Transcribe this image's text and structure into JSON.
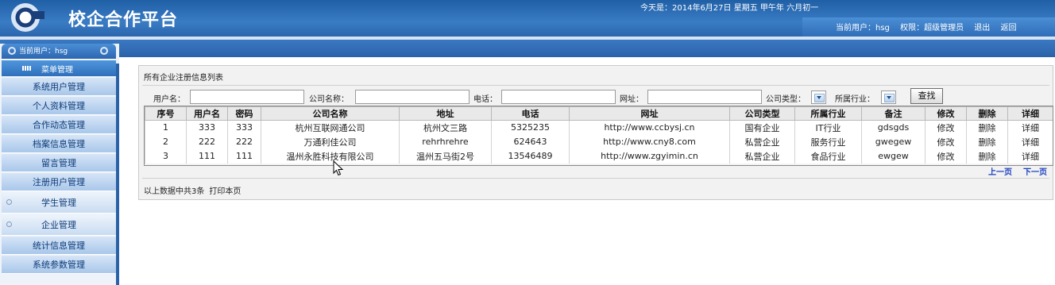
{
  "header": {
    "title": "校企合作平台",
    "date": "今天是：2014年6月27日 星期五 甲午年 六月初一",
    "current_user_label": "当前用户：hsg",
    "permission_label": "权限：超级管理员",
    "logout": "退出",
    "back": "返回"
  },
  "sidebar": {
    "user_label": "当前用户：hsg",
    "menu_head": "菜单管理",
    "items": [
      {
        "label": "系统用户管理"
      },
      {
        "label": "个人资料管理"
      },
      {
        "label": "合作动态管理"
      },
      {
        "label": "档案信息管理"
      },
      {
        "label": "留言管理"
      },
      {
        "label": "注册用户管理"
      },
      {
        "label": "学生管理"
      },
      {
        "label": "企业管理"
      },
      {
        "label": "统计信息管理"
      },
      {
        "label": "系统参数管理"
      }
    ]
  },
  "panel": {
    "title": "所有企业注册信息列表",
    "search": {
      "username_label": "用户名：",
      "company_label": "公司名称：",
      "phone_label": "电话：",
      "url_label": "网址：",
      "type_label": "公司类型：",
      "industry_label": "所属行业：",
      "search_button": "查找"
    },
    "columns": [
      "序号",
      "用户名",
      "密码",
      "公司名称",
      "地址",
      "电话",
      "网址",
      "公司类型",
      "所属行业",
      "备注",
      "修改",
      "删除",
      "详细"
    ],
    "rows": [
      [
        "1",
        "333",
        "333",
        "杭州互联网通公司",
        "杭州文三路",
        "5325235",
        "http://www.ccbysj.cn",
        "国有企业",
        "IT行业",
        "gdsgds",
        "修改",
        "删除",
        "详细"
      ],
      [
        "2",
        "222",
        "222",
        "万通利佳公司",
        "rehrhrehre",
        "624643",
        "http://www.cny8.com",
        "私营企业",
        "服务行业",
        "gwegew",
        "修改",
        "删除",
        "详细"
      ],
      [
        "3",
        "111",
        "111",
        "温州永胜科技有限公司",
        "温州五马街2号",
        "13546489",
        "http://www.zgyimin.cn",
        "私营企业",
        "食品行业",
        "ewgew",
        "修改",
        "删除",
        "详细"
      ]
    ],
    "prev_page": "上一页",
    "next_page": "下一页",
    "summary": "以上数据中共3条",
    "print": "打印本页"
  }
}
